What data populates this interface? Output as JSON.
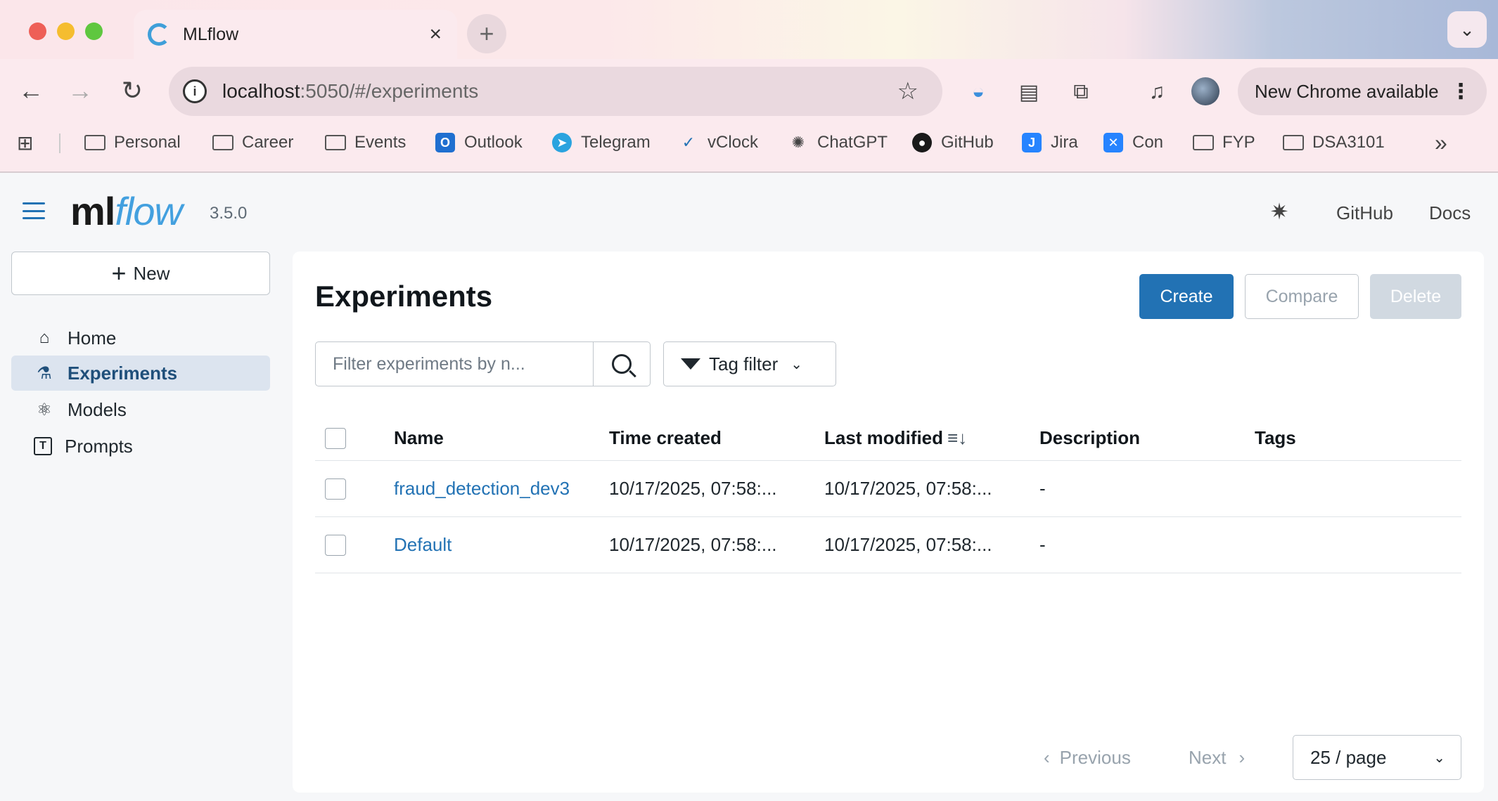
{
  "browser": {
    "tab_title": "MLflow",
    "tab_close": "×",
    "new_tab": "+",
    "url_host": "localhost",
    "url_rest": ":5050/#/experiments",
    "update_label": "New Chrome available",
    "bookmarks": [
      {
        "label": "Personal",
        "icon": "folder-icon"
      },
      {
        "label": "Career",
        "icon": "folder-icon"
      },
      {
        "label": "Events",
        "icon": "folder-icon"
      },
      {
        "label": "Outlook",
        "icon": "outlook-icon"
      },
      {
        "label": "Telegram",
        "icon": "telegram-icon"
      },
      {
        "label": "vClock",
        "icon": "vclock-icon"
      },
      {
        "label": "ChatGPT",
        "icon": "chatgpt-icon"
      },
      {
        "label": "GitHub",
        "icon": "github-icon"
      },
      {
        "label": "Jira",
        "icon": "jira-icon"
      },
      {
        "label": "Con",
        "icon": "confluence-icon"
      },
      {
        "label": "FYP",
        "icon": "folder-icon"
      },
      {
        "label": "DSA3101",
        "icon": "folder-icon"
      }
    ],
    "bookmarks_overflow": "»"
  },
  "app": {
    "logo_ml": "ml",
    "logo_flow": "flow",
    "version": "3.5.0",
    "github_link": "GitHub",
    "docs_link": "Docs",
    "new_button": "New",
    "nav": [
      {
        "label": "Home",
        "icon": "home-icon"
      },
      {
        "label": "Experiments",
        "icon": "flask-icon",
        "active": true
      },
      {
        "label": "Models",
        "icon": "models-icon"
      },
      {
        "label": "Prompts",
        "icon": "prompts-icon"
      }
    ]
  },
  "experiments": {
    "title": "Experiments",
    "create_label": "Create",
    "compare_label": "Compare",
    "delete_label": "Delete",
    "filter_placeholder": "Filter experiments by n...",
    "tag_filter_label": "Tag filter",
    "columns": [
      "Name",
      "Time created",
      "Last modified",
      "Description",
      "Tags"
    ],
    "rows": [
      {
        "name": "fraud_detection_dev3",
        "time_created": "10/17/2025, 07:58:...",
        "last_modified": "10/17/2025, 07:58:...",
        "description": "-",
        "tags": ""
      },
      {
        "name": "Default",
        "time_created": "10/17/2025, 07:58:...",
        "last_modified": "10/17/2025, 07:58:...",
        "description": "-",
        "tags": ""
      }
    ],
    "pagination": {
      "previous": "Previous",
      "next": "Next",
      "page_size": "25 / page"
    }
  },
  "colors": {
    "primary": "#2272b4",
    "link": "#2272b4",
    "sidebar_active_bg": "#dce4ef"
  }
}
